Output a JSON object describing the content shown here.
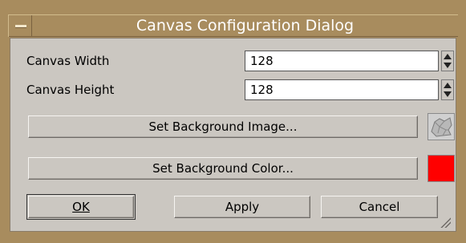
{
  "window": {
    "title": "Canvas Configuration Dialog"
  },
  "fields": {
    "width": {
      "label": "Canvas Width",
      "value": "128"
    },
    "height": {
      "label": "Canvas Height",
      "value": "128"
    }
  },
  "buttons": {
    "set_background_image": "Set Background Image...",
    "set_background_color": "Set Background Color...",
    "ok": "OK",
    "apply": "Apply",
    "cancel": "Cancel"
  },
  "background_color": "#ff0000",
  "icons": {
    "window_menu": "window-menu-icon",
    "background_image_thumbnail": "background-image-thumbnail"
  }
}
